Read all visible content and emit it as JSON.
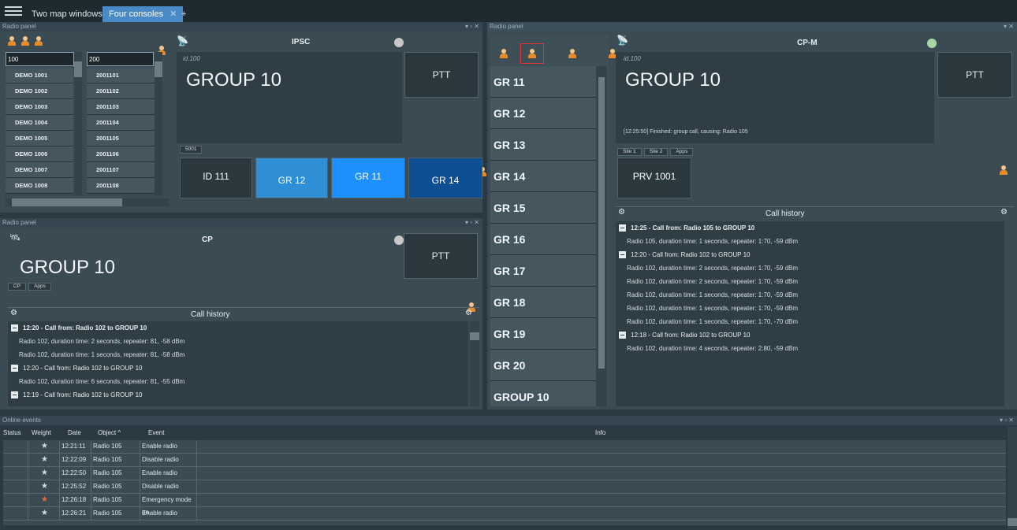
{
  "tabs": {
    "tab1": "Two map windows",
    "tab2": "Four consoles",
    "close": "✕",
    "add": "+"
  },
  "panel_titles": {
    "radio_panel": "Radio panel",
    "online_events": "Online events",
    "ctl": "▾ ▫ ✕",
    "ctl2": "▾ ✕"
  },
  "p1": {
    "search1": "100",
    "search2": "200",
    "list": [
      [
        "DEMO 1001",
        "2001101"
      ],
      [
        "DEMO 1002",
        "2001102"
      ],
      [
        "DEMO 1003",
        "2001103"
      ],
      [
        "DEMO 1004",
        "2001104"
      ],
      [
        "DEMO 1005",
        "2001105"
      ],
      [
        "DEMO 1006",
        "2001106"
      ],
      [
        "DEMO 1007",
        "2001107"
      ],
      [
        "DEMO 1008",
        "2001108"
      ]
    ],
    "title": "IPSC",
    "id": "id.100",
    "group": "GROUP 10",
    "ptt": "PTT",
    "tag": "5001",
    "tiles": [
      "ID 111",
      "GR 12",
      "GR 11",
      "GR 14"
    ]
  },
  "p2": {
    "title": "CP",
    "group": "GROUP 10",
    "ptt": "PTT",
    "btn1": "CP",
    "btn2": "Apps",
    "call_history": "Call history",
    "history": [
      {
        "type": "head",
        "bold": true,
        "text": "12:20 - Call from: Radio 102 to GROUP 10"
      },
      {
        "type": "line",
        "text": "Radio 102, duration time: 2 seconds, repeater: 81, -58 dBm"
      },
      {
        "type": "line",
        "text": "Radio 102, duration time: 1 seconds, repeater: 81, -58 dBm"
      },
      {
        "type": "head",
        "bold": false,
        "text": "12:20 - Call from: Radio 102 to GROUP 10"
      },
      {
        "type": "line",
        "text": "Radio 102, duration time: 6 seconds, repeater: 81, -55 dBm"
      },
      {
        "type": "head",
        "bold": false,
        "text": "12:19 - Call from: Radio 102 to GROUP 10"
      }
    ]
  },
  "p3": {
    "groups": [
      "GR 11",
      "GR 12",
      "GR 13",
      "GR 14",
      "GR 15",
      "GR 16",
      "GR 17",
      "GR 18",
      "GR 19",
      "GR 20",
      "GROUP 10"
    ],
    "title": "CP-M",
    "id": "id.100",
    "group": "GROUP 10",
    "ptt": "PTT",
    "status": "[12:25:50] Finished: group call, causing: Radio 105",
    "btn1": "Site 1",
    "btn2": "Site 2",
    "btn3": "Apps",
    "tile": "PRV 1001",
    "call_history": "Call history",
    "history": [
      {
        "type": "head",
        "bold": true,
        "text": "12:25 - Call from: Radio 105 to GROUP 10"
      },
      {
        "type": "line",
        "text": "Radio 105, duration time: 1 seconds, repeater: 1:70, -59 dBm"
      },
      {
        "type": "head",
        "bold": false,
        "text": "12:20 - Call from: Radio 102 to GROUP 10"
      },
      {
        "type": "line",
        "text": "Radio 102, duration time: 2 seconds, repeater: 1:70, -59 dBm"
      },
      {
        "type": "line",
        "text": "Radio 102, duration time: 2 seconds, repeater: 1:70, -59 dBm"
      },
      {
        "type": "line",
        "text": "Radio 102, duration time: 1 seconds, repeater: 1:70, -59 dBm"
      },
      {
        "type": "line",
        "text": "Radio 102, duration time: 1 seconds, repeater: 1:70, -59 dBm"
      },
      {
        "type": "line",
        "text": "Radio 102, duration time: 1 seconds, repeater: 1:70, -70 dBm"
      },
      {
        "type": "head",
        "bold": false,
        "text": "12:18 - Call from: Radio 102 to GROUP 10"
      },
      {
        "type": "line",
        "text": "Radio 102, duration time: 4 seconds, repeater: 2:80, -59 dBm"
      }
    ]
  },
  "events": {
    "headers": {
      "status": "Status",
      "weight": "Weight",
      "date": "Date",
      "object": "Object ^",
      "event": "Event",
      "info": "Info"
    },
    "rows": [
      {
        "date": "12:21:11",
        "object": "Radio 105",
        "event": "Enable radio",
        "alert": false
      },
      {
        "date": "12:22:09",
        "object": "Radio 105",
        "event": "Disable radio",
        "alert": false
      },
      {
        "date": "12:22:50",
        "object": "Radio 105",
        "event": "Enable radio",
        "alert": false
      },
      {
        "date": "12:25:52",
        "object": "Radio 105",
        "event": "Disable radio",
        "alert": false
      },
      {
        "date": "12:26:18",
        "object": "Radio 105",
        "event": "Emergency mode on",
        "alert": true
      },
      {
        "date": "12:26:21",
        "object": "Radio 105",
        "event": "Enable radio",
        "alert": false
      }
    ]
  },
  "colors": {
    "accent": "#4a8ac7",
    "tile_blue": "#2f8fd6",
    "tile_bright": "#1e90ff",
    "tile_dark": "#0e4f94",
    "star_alert": "#e8663d"
  }
}
